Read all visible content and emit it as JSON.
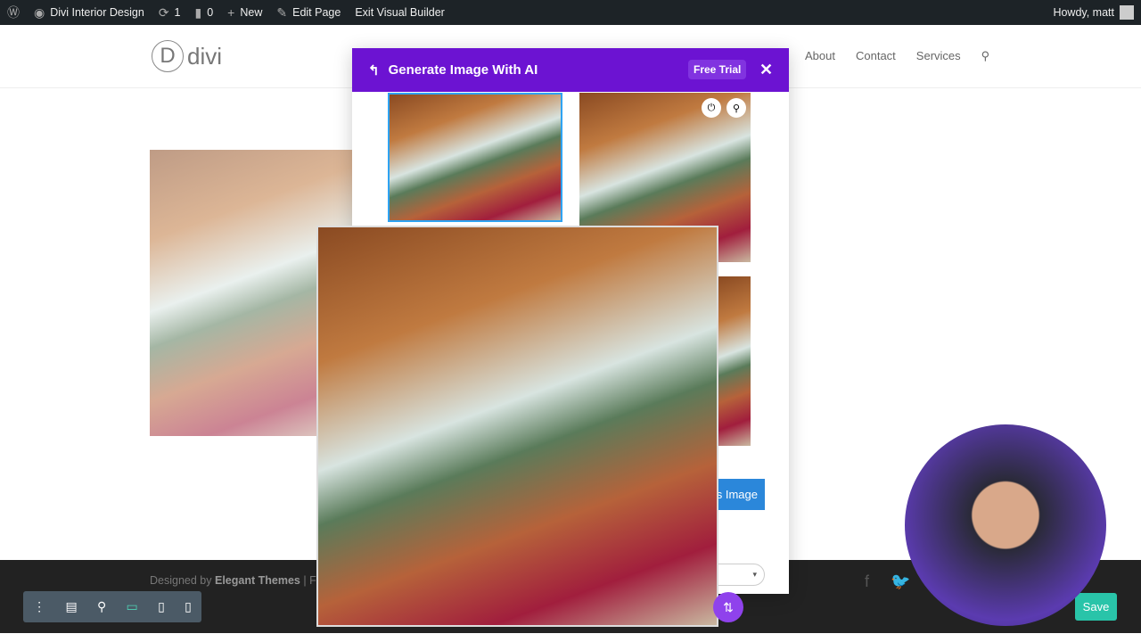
{
  "admin_bar": {
    "site": "Divi Interior Design",
    "updates": "1",
    "comments": "0",
    "new": "New",
    "edit": "Edit Page",
    "exit": "Exit Visual Builder",
    "howdy": "Howdy, matt"
  },
  "header": {
    "logo": "divi",
    "logo_mark": "D",
    "nav": [
      "About",
      "Contact",
      "Services"
    ]
  },
  "modal": {
    "title": "Generate Image With AI",
    "free_trial": "Free Trial",
    "generate_button": "s Image"
  },
  "footer": {
    "designed_by": "Designed by",
    "brand": "Elegant Themes",
    "sep": "| F"
  },
  "save": "Save"
}
